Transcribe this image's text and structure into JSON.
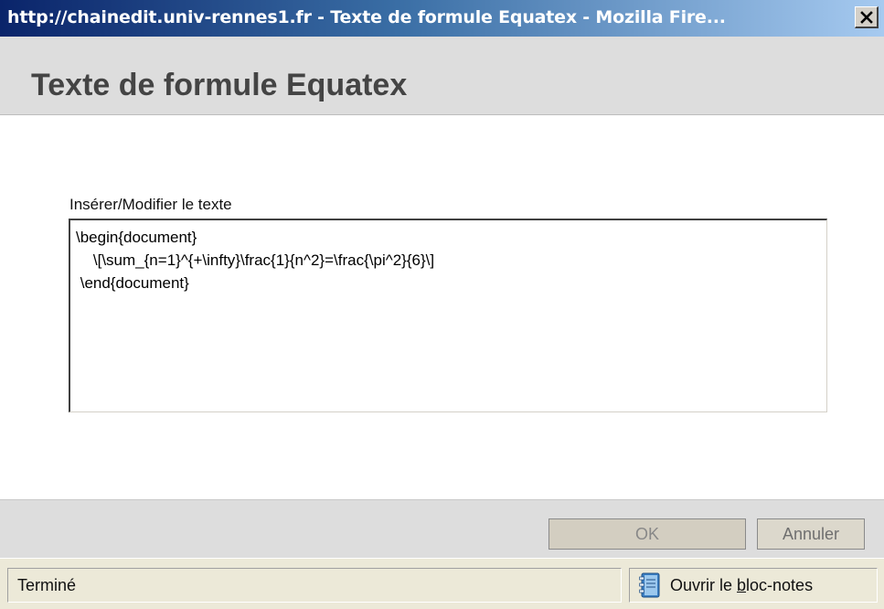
{
  "window": {
    "title": "http://chainedit.univ-rennes1.fr - Texte de formule Equatex - Mozilla Fire..."
  },
  "dialog": {
    "heading": "Texte de formule Equatex",
    "field_label": "Insérer/Modifier le texte",
    "textarea_value": "\\begin{document}\n    \\[\\sum_{n=1}^{+\\infty}\\frac{1}{n^2}=\\frac{\\pi^2}{6}\\]\n \\end{document}"
  },
  "buttons": {
    "ok_label": "OK",
    "cancel_label": "Annuler"
  },
  "statusbar": {
    "status_text": "Terminé",
    "notepad_prefix": "Ouvrir le ",
    "notepad_underlined": "b",
    "notepad_suffix": "loc-notes",
    "notepad_icon": "notepad-icon"
  },
  "colors": {
    "titlebar_start": "#0a246a",
    "titlebar_end": "#a6caf0",
    "header_bg": "#dddddd",
    "statusbar_bg": "#ece9d8"
  }
}
